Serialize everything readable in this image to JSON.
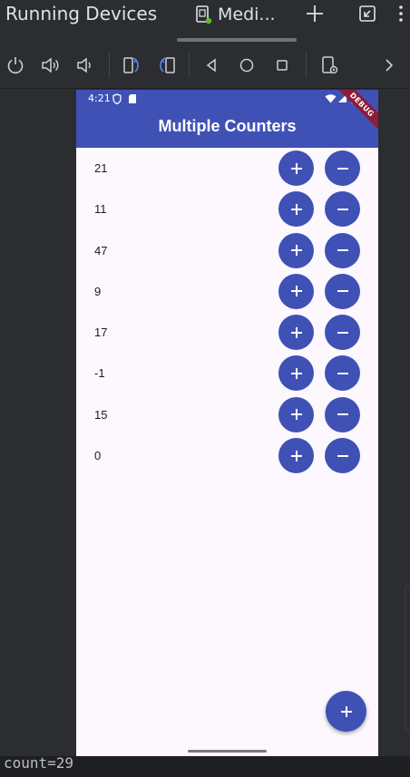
{
  "ide": {
    "window_title": "Running Devices",
    "tab_label": "Medi...",
    "toolbar_icons": [
      "power-icon",
      "volume-up-icon",
      "volume-down-icon",
      "rotate-left-icon",
      "rotate-right-icon",
      "back-icon",
      "home-icon",
      "overview-icon",
      "device-settings-icon",
      "chevron-right-icon"
    ]
  },
  "phone": {
    "status_time": "4:21",
    "app_title": "Multiple Counters",
    "debug_label": "DEBUG",
    "accent_color": "#3f51b5",
    "counters": [
      {
        "value": "21"
      },
      {
        "value": "11"
      },
      {
        "value": "47"
      },
      {
        "value": "9"
      },
      {
        "value": "17"
      },
      {
        "value": "-1"
      },
      {
        "value": "15"
      },
      {
        "value": "0"
      }
    ]
  },
  "log": {
    "line": "count=29"
  }
}
